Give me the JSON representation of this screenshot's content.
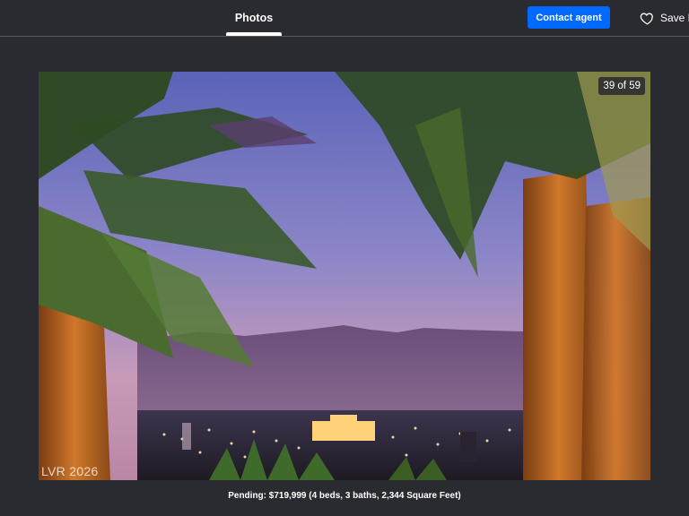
{
  "header": {
    "tab_photos": "Photos",
    "contact_label": "Contact agent",
    "save_label": "Save Home",
    "contact_color": "#006aff"
  },
  "photo": {
    "counter": "39 of 59",
    "watermark": "LVR 2026",
    "icon": "heart-icon"
  },
  "caption": "Pending: $719,999 (4 beds, 3 baths, 2,344 Square Feet)"
}
